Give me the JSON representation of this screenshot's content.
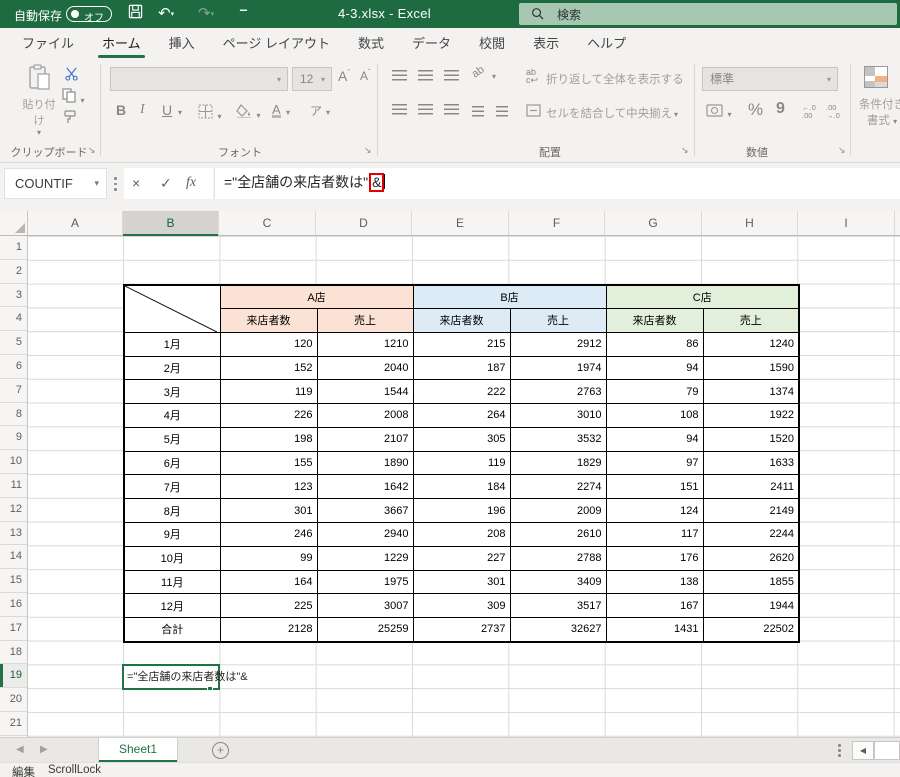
{
  "colors": {
    "accent": "#217346",
    "titlebar_green": "#1E6B41",
    "search_bg": "#A6C8B3",
    "highlight_red": "#E00000",
    "store_a": "#FBE2D5",
    "store_b": "#DDEBF7",
    "store_c": "#E2EFDA"
  },
  "titlebar": {
    "autosave_label": "自動保存",
    "autosave_state": "オフ",
    "title": "4-3.xlsx  -  Excel",
    "search_placeholder": "検索"
  },
  "tabs": {
    "items": [
      "ファイル",
      "ホーム",
      "挿入",
      "ページ レイアウト",
      "数式",
      "データ",
      "校閲",
      "表示",
      "ヘルプ"
    ],
    "active": "ホーム"
  },
  "ribbon": {
    "paste_label": "貼り付け",
    "clipboard_group": "クリップボード",
    "font_group": "フォント",
    "font_size": "12",
    "bold": "B",
    "italic": "I",
    "underline": "U",
    "phonetic": "ア",
    "wrap_text": "折り返して全体を表示する",
    "merge_center": "セルを結合して中央揃え",
    "alignment_group": "配置",
    "number_format": "標準",
    "percent": "%",
    "comma": "9",
    "number_group": "数値",
    "conditional_line1": "条件付き",
    "conditional_line2": "書式"
  },
  "formula_bar": {
    "name_box": "COUNTIF",
    "cancel": "×",
    "enter": "✓",
    "fx": "fx",
    "formula_prefix": "=\"全店舗の来店者数は\"",
    "formula_highlight": "&"
  },
  "grid": {
    "col_headers": [
      "A",
      "B",
      "C",
      "D",
      "E",
      "F",
      "G",
      "H",
      "I"
    ],
    "row_count": 21,
    "selected_col": "B",
    "selected_row": 19
  },
  "table": {
    "stores": [
      {
        "name": "A店",
        "color": "#FBE2D5"
      },
      {
        "name": "B店",
        "color": "#DDEBF7"
      },
      {
        "name": "C店",
        "color": "#E2EFDA"
      }
    ],
    "subheaders": [
      "来店者数",
      "売上"
    ],
    "rows": [
      {
        "label": "1月",
        "values": [
          120,
          1210,
          215,
          2912,
          86,
          1240
        ]
      },
      {
        "label": "2月",
        "values": [
          152,
          2040,
          187,
          1974,
          94,
          1590
        ]
      },
      {
        "label": "3月",
        "values": [
          119,
          1544,
          222,
          2763,
          79,
          1374
        ]
      },
      {
        "label": "4月",
        "values": [
          226,
          2008,
          264,
          3010,
          108,
          1922
        ]
      },
      {
        "label": "5月",
        "values": [
          198,
          2107,
          305,
          3532,
          94,
          1520
        ]
      },
      {
        "label": "6月",
        "values": [
          155,
          1890,
          119,
          1829,
          97,
          1633
        ]
      },
      {
        "label": "7月",
        "values": [
          123,
          1642,
          184,
          2274,
          151,
          2411
        ]
      },
      {
        "label": "8月",
        "values": [
          301,
          3667,
          196,
          2009,
          124,
          2149
        ]
      },
      {
        "label": "9月",
        "values": [
          246,
          2940,
          208,
          2610,
          117,
          2244
        ]
      },
      {
        "label": "10月",
        "values": [
          99,
          1229,
          227,
          2788,
          176,
          2620
        ]
      },
      {
        "label": "11月",
        "values": [
          164,
          1975,
          301,
          3409,
          138,
          1855
        ]
      },
      {
        "label": "12月",
        "values": [
          225,
          3007,
          309,
          3517,
          167,
          1944
        ]
      },
      {
        "label": "合計",
        "values": [
          2128,
          25259,
          2737,
          32627,
          1431,
          22502
        ]
      }
    ]
  },
  "edit_cell": {
    "address": "B19",
    "text": "=\"全店舗の来店者数は\"&"
  },
  "sheet_bar": {
    "tabs": [
      "Sheet1"
    ],
    "active": "Sheet1"
  },
  "status_bar": {
    "mode": "編集",
    "keys": "ScrollLock"
  }
}
